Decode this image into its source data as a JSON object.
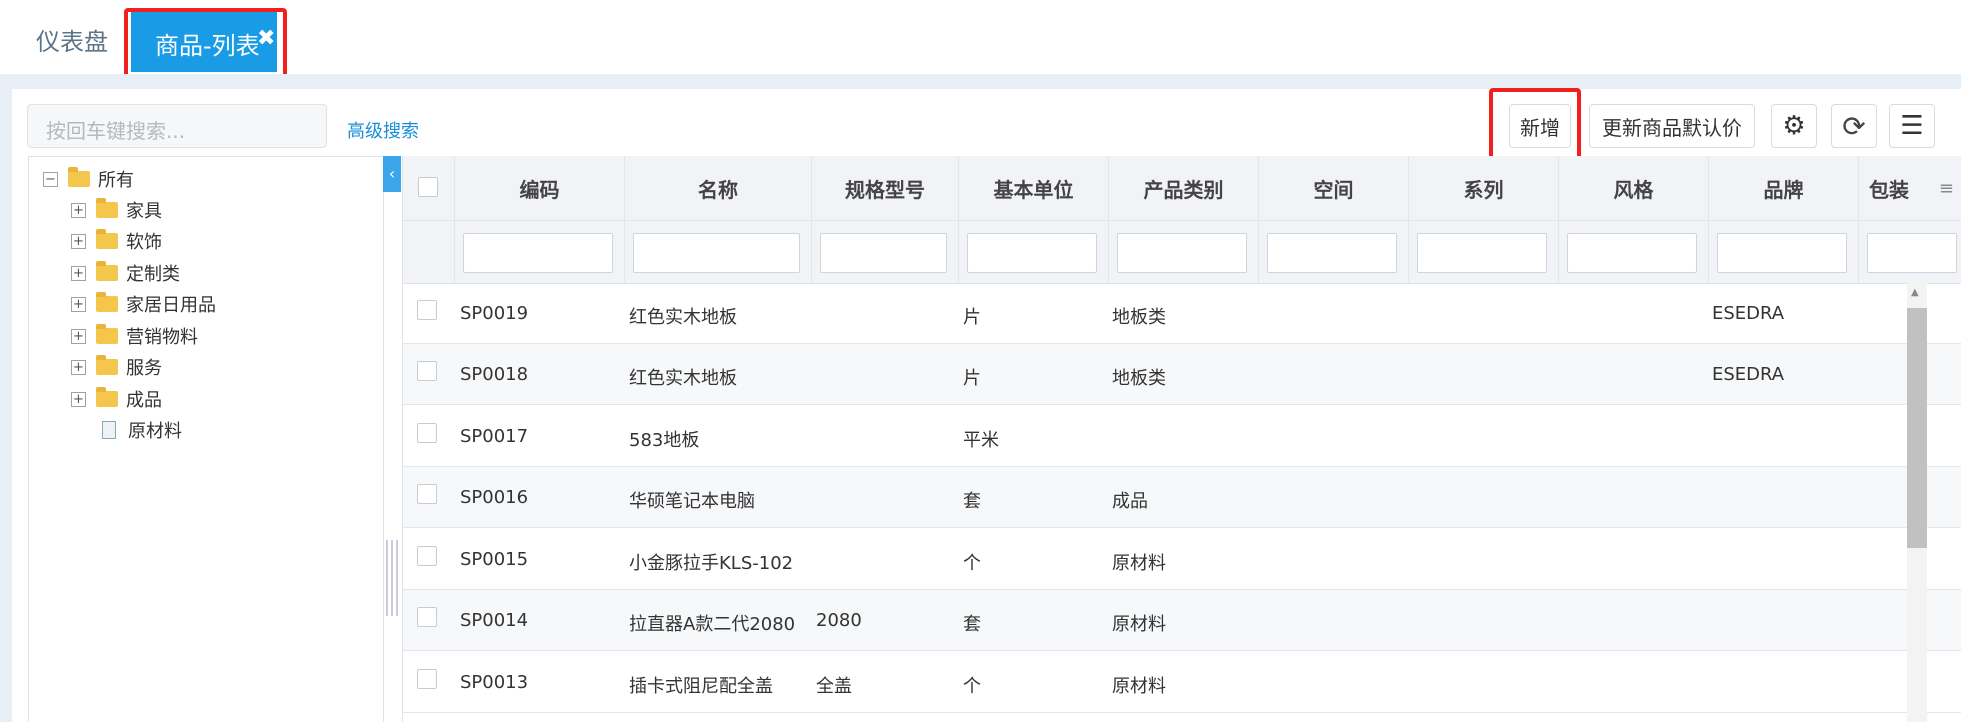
{
  "tabs": {
    "dashboard": "仪表盘",
    "active": "商品-列表",
    "close": "✖"
  },
  "toolbar": {
    "search_placeholder": "按回车键搜索...",
    "advanced_search": "高级搜索",
    "add": "新增",
    "update_default_price": "更新商品默认价"
  },
  "icons": {
    "gear": "⚙",
    "refresh": "⟳",
    "menu": "☰",
    "collapse": "‹",
    "column_menu": "≡",
    "scroll_up": "▲"
  },
  "tree": {
    "root": "所有",
    "children": [
      "家具",
      "软饰",
      "定制类",
      "家居日用品",
      "营销物料",
      "服务",
      "成品",
      "原材料"
    ]
  },
  "grid": {
    "columns": [
      "编码",
      "名称",
      "规格型号",
      "基本单位",
      "产品类别",
      "空间",
      "系列",
      "风格",
      "品牌",
      "包装"
    ],
    "rows": [
      [
        "SP0019",
        "红色实木地板",
        "",
        "片",
        "地板类",
        "",
        "",
        "",
        "ESEDRA"
      ],
      [
        "SP0018",
        "红色实木地板",
        "",
        "片",
        "地板类",
        "",
        "",
        "",
        "ESEDRA"
      ],
      [
        "SP0017",
        "583地板",
        "",
        "平米",
        "",
        "",
        "",
        "",
        ""
      ],
      [
        "SP0016",
        "华硕笔记本电脑",
        "",
        "套",
        "成品",
        "",
        "",
        "",
        ""
      ],
      [
        "SP0015",
        "小金豚拉手KLS-102",
        "",
        "个",
        "原材料",
        "",
        "",
        "",
        ""
      ],
      [
        "SP0014",
        "拉直器A款二代2080",
        "2080",
        "套",
        "原材料",
        "",
        "",
        "",
        ""
      ],
      [
        "SP0013",
        "插卡式阻尼配全盖",
        "全盖",
        "个",
        "原材料",
        "",
        "",
        "",
        ""
      ]
    ]
  },
  "colors": {
    "accent": "#1a9be6",
    "highlight": "#f31f1f"
  }
}
